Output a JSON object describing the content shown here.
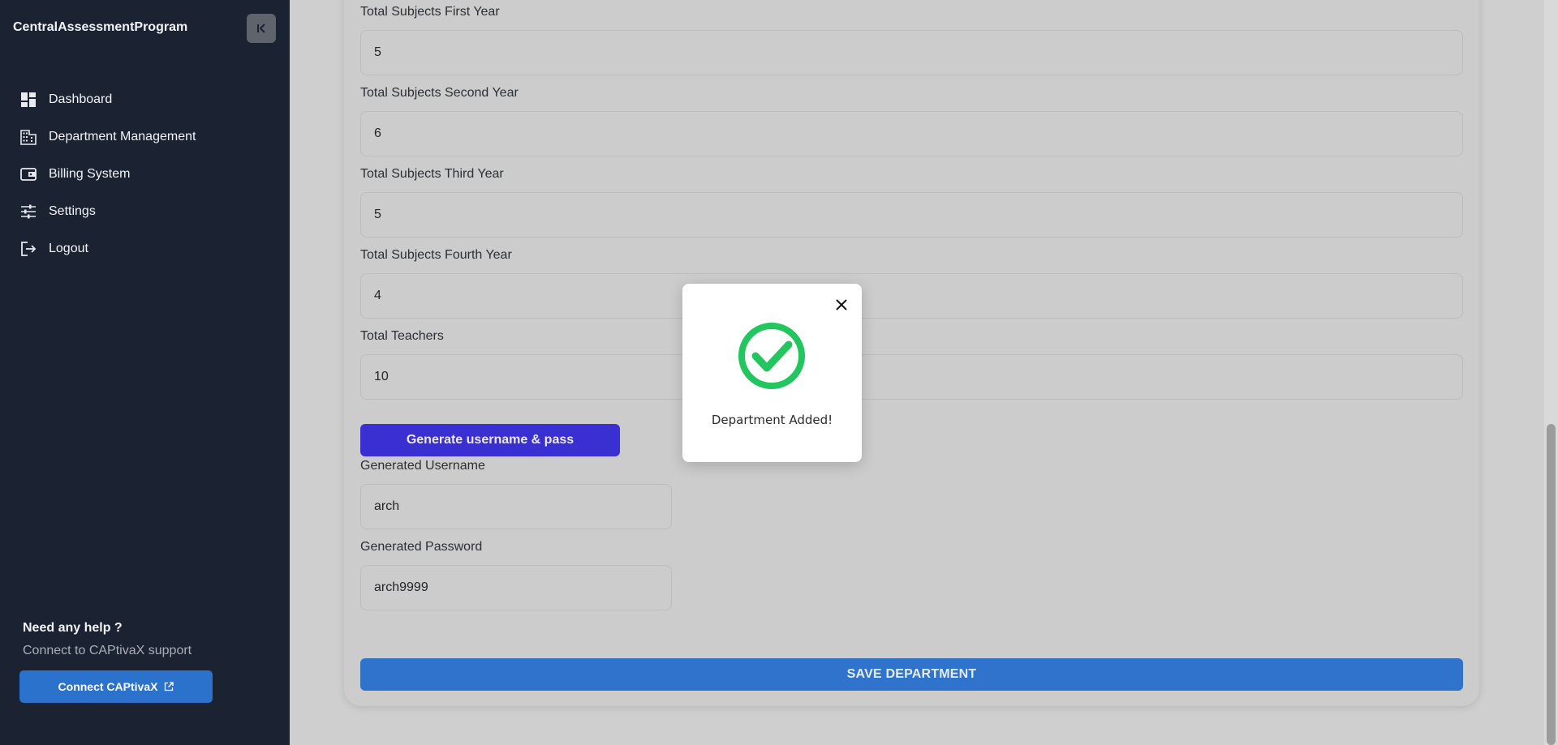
{
  "sidebar": {
    "brand": "CentralAssessmentProgram",
    "items": [
      {
        "label": "Dashboard",
        "icon": "dashboard-icon"
      },
      {
        "label": "Department Management",
        "icon": "building-icon"
      },
      {
        "label": "Billing System",
        "icon": "wallet-icon"
      },
      {
        "label": "Settings",
        "icon": "sliders-icon"
      },
      {
        "label": "Logout",
        "icon": "logout-icon"
      }
    ],
    "help_title": "Need any help ?",
    "help_subtitle": "Connect to CAPtivaX support",
    "connect_label": "Connect CAPtivaX"
  },
  "form": {
    "fields": [
      {
        "label": "Total Subjects First Year",
        "value": "5"
      },
      {
        "label": "Total Subjects Second Year",
        "value": "6"
      },
      {
        "label": "Total Subjects Third Year",
        "value": "5"
      },
      {
        "label": "Total Subjects Fourth Year",
        "value": "4"
      },
      {
        "label": "Total Teachers",
        "value": "10"
      }
    ],
    "generate_label": "Generate username & pass",
    "username_label": "Generated Username",
    "username_value": "arch",
    "password_label": "Generated Password",
    "password_value": "arch9999",
    "save_label": "SAVE DEPARTMENT"
  },
  "modal": {
    "message": "Department Added!"
  },
  "colors": {
    "sidebar_bg": "#1b2231",
    "generate_button": "#3a2fd0",
    "save_button": "#2f73cc",
    "success_green": "#22c55e"
  }
}
